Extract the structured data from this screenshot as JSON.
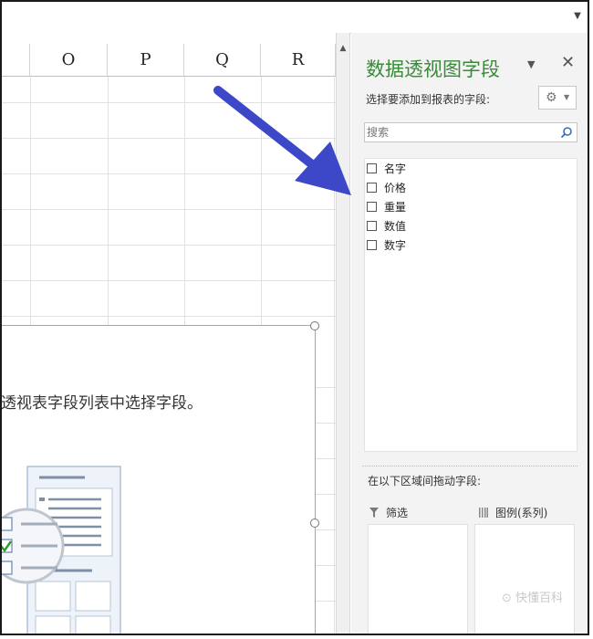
{
  "columns": [
    "O",
    "P",
    "Q",
    "R"
  ],
  "chart": {
    "hint": "透视表字段列表中选择字段。"
  },
  "panel": {
    "title": "数据透视图字段",
    "subtitle": "选择要添加到报表的字段:",
    "search_placeholder": "搜索",
    "fields": [
      {
        "label": "名字",
        "checked": false
      },
      {
        "label": "价格",
        "checked": false
      },
      {
        "label": "重量",
        "checked": false
      },
      {
        "label": "数值",
        "checked": false
      },
      {
        "label": "数字",
        "checked": false
      }
    ],
    "drag_hint": "在以下区域间拖动字段:",
    "areas": {
      "filter": "筛选",
      "legend": "图例(系列)"
    }
  },
  "icons": {
    "dropdown": "chevron-down-icon",
    "close": "close-icon",
    "gear": "gear-icon",
    "search": "search-icon",
    "filter": "filter-icon",
    "legend": "legend-columns-icon"
  },
  "colors": {
    "panel_title": "#3a8a3a",
    "arrow": "#3c48c8"
  },
  "watermark": "⊙ 快懂百科"
}
